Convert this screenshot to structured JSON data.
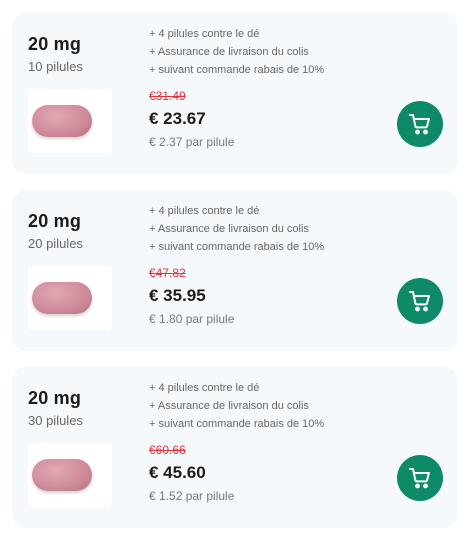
{
  "products": [
    {
      "dose": "20 mg",
      "quantity": "10 pilules",
      "features": [
        "+ 4 pilules contre le dé",
        "+ Assurance de livraison du colis",
        "+ suivant commande rabais de 10%"
      ],
      "old_price": "€31.49",
      "price": "€ 23.67",
      "per_pill": "€ 2.37 par pilule",
      "icons": {
        "pill": "pill-image",
        "cart": "cart-icon"
      }
    },
    {
      "dose": "20 mg",
      "quantity": "20 pilules",
      "features": [
        "+ 4 pilules contre le dé",
        "+ Assurance de livraison du colis",
        "+ suivant commande rabais de 10%"
      ],
      "old_price": "€47.82",
      "price": "€ 35.95",
      "per_pill": "€ 1.80 par pilule",
      "icons": {
        "pill": "pill-image",
        "cart": "cart-icon"
      }
    },
    {
      "dose": "20 mg",
      "quantity": "30 pilules",
      "features": [
        "+ 4 pilules contre le dé",
        "+ Assurance de livraison du colis",
        "+ suivant commande rabais de 10%"
      ],
      "old_price": "€60.66",
      "price": "€ 45.60",
      "per_pill": "€ 1.52 par pilule",
      "icons": {
        "pill": "pill-image",
        "cart": "cart-icon"
      }
    }
  ],
  "colors": {
    "card_bg": "#f6f9fc",
    "accent": "#0e8a68",
    "old_price": "#e0323a",
    "pill": "#d08d9c"
  }
}
